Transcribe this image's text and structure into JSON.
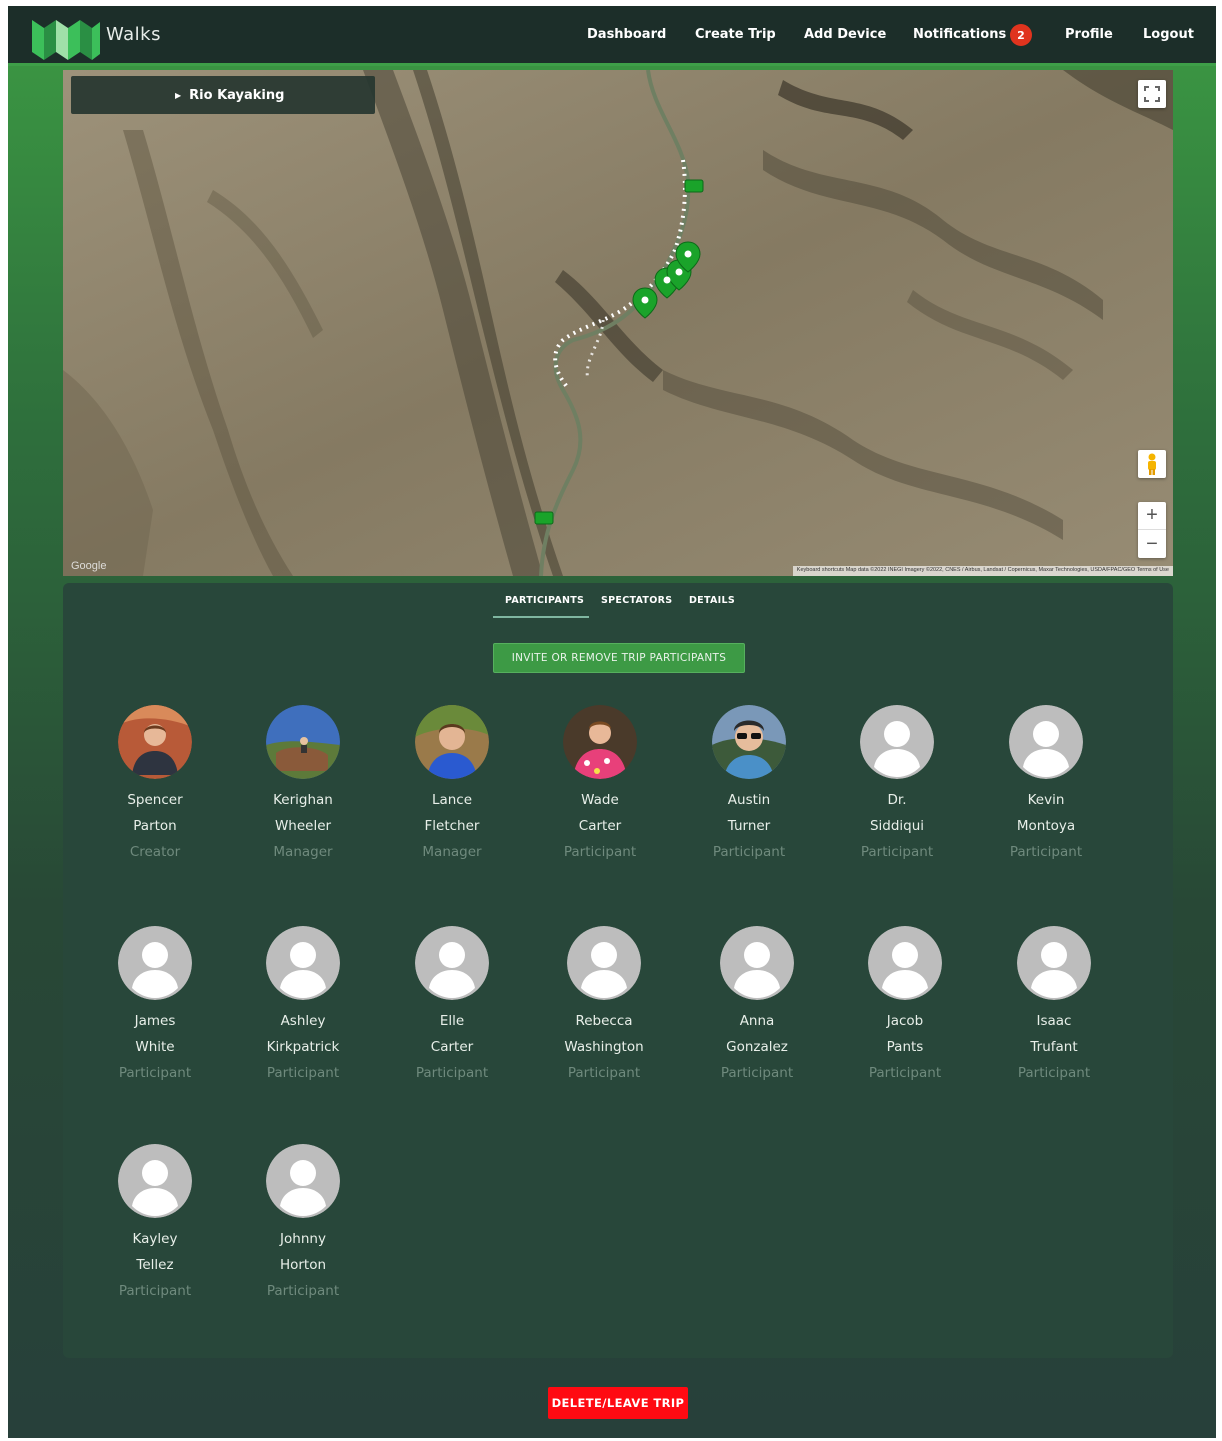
{
  "app": {
    "brand": "Walks"
  },
  "nav": {
    "dashboard": "Dashboard",
    "create_trip": "Create Trip",
    "add_device": "Add Device",
    "notifications": "Notifications",
    "notifications_count": "2",
    "profile": "Profile",
    "logout": "Logout"
  },
  "map": {
    "trip_name": "Rio Kayaking",
    "google_label": "Google",
    "attribution": "Keyboard shortcuts   Map data ©2022 INEGI Imagery ©2022, CNES / Airbus, Landsat / Copernicus, Maxar Technologies, USDA/FPAC/GEO   Terms of Use",
    "zoom_in": "+",
    "zoom_out": "−"
  },
  "tabs": {
    "participants": "PARTICIPANTS",
    "spectators": "SPECTATORS",
    "details": "DETAILS"
  },
  "invite_button": "INVITE OR REMOVE TRIP PARTICIPANTS",
  "participants": [
    {
      "first": "Spencer",
      "last": "Parton",
      "role": "Creator",
      "photo": "photo-red-rock"
    },
    {
      "first": "Kerighan",
      "last": "Wheeler",
      "role": "Manager",
      "photo": "photo-landscape"
    },
    {
      "first": "Lance",
      "last": "Fletcher",
      "role": "Manager",
      "photo": "photo-blue-shirt"
    },
    {
      "first": "Wade",
      "last": "Carter",
      "role": "Participant",
      "photo": "photo-floral-shirt"
    },
    {
      "first": "Austin",
      "last": "Turner",
      "role": "Participant",
      "photo": "photo-sunglasses"
    },
    {
      "first": "Dr.",
      "last": "Siddiqui",
      "role": "Participant",
      "photo": "default-avatar"
    },
    {
      "first": "Kevin",
      "last": "Montoya",
      "role": "Participant",
      "photo": "default-avatar"
    },
    {
      "first": "James",
      "last": "White",
      "role": "Participant",
      "photo": "default-avatar"
    },
    {
      "first": "Ashley",
      "last": "Kirkpatrick",
      "role": "Participant",
      "photo": "default-avatar"
    },
    {
      "first": "Elle",
      "last": "Carter",
      "role": "Participant",
      "photo": "default-avatar"
    },
    {
      "first": "Rebecca",
      "last": "Washington",
      "role": "Participant",
      "photo": "default-avatar"
    },
    {
      "first": "Anna",
      "last": "Gonzalez",
      "role": "Participant",
      "photo": "default-avatar"
    },
    {
      "first": "Jacob",
      "last": "Pants",
      "role": "Participant",
      "photo": "default-avatar"
    },
    {
      "first": "Isaac",
      "last": "Trufant",
      "role": "Participant",
      "photo": "default-avatar"
    },
    {
      "first": "Kayley",
      "last": "Tellez",
      "role": "Participant",
      "photo": "default-avatar"
    },
    {
      "first": "Johnny",
      "last": "Horton",
      "role": "Participant",
      "photo": "default-avatar"
    }
  ],
  "delete_button": "DELETE/LEAVE TRIP",
  "colors": {
    "nav_bg": "#1c2e29",
    "accent_green": "#3d9a45",
    "card_bg": "#28473a",
    "badge_red": "#e0341e",
    "delete_red": "#ff0a12"
  }
}
